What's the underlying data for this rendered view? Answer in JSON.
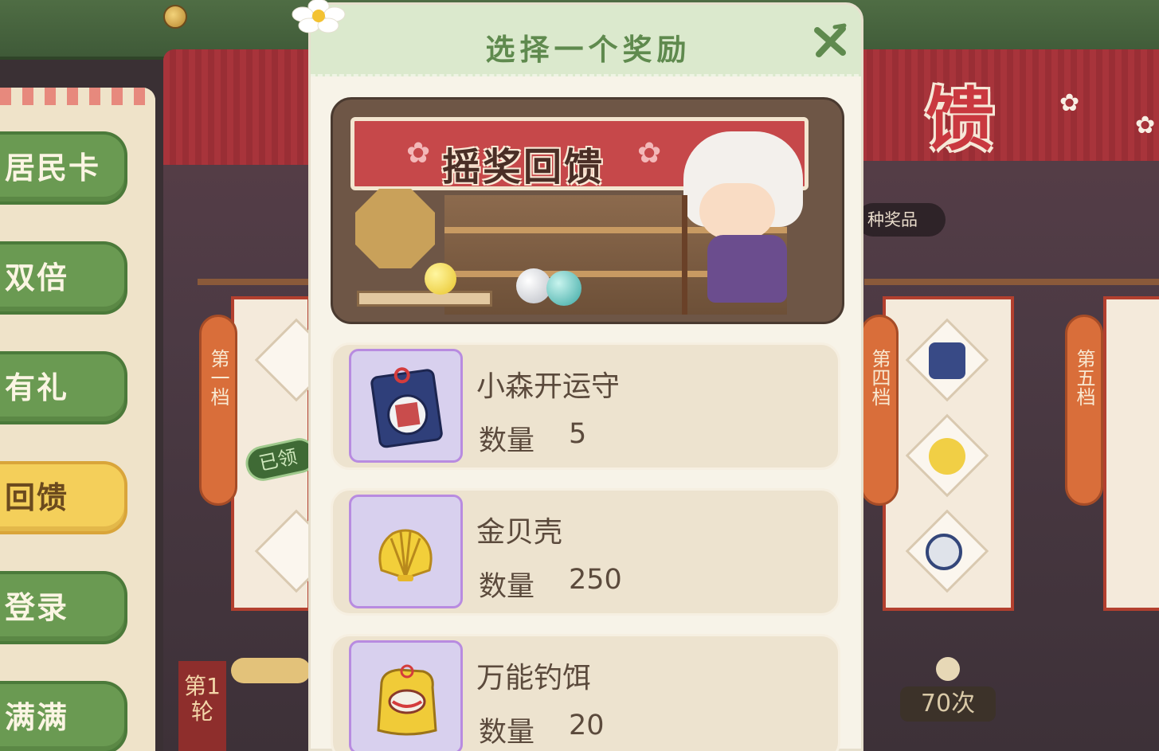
{
  "dialog": {
    "title": "选择一个奖励",
    "close_icon": "close-x-icon",
    "banner_text": "摇奖回馈"
  },
  "rewards": [
    {
      "name": "小森开运守",
      "qty_label": "数量",
      "qty": "5",
      "icon": "charm-amulet-icon"
    },
    {
      "name": "金贝壳",
      "qty_label": "数量",
      "qty": "250",
      "icon": "gold-shell-icon"
    },
    {
      "name": "万能钓饵",
      "qty_label": "数量",
      "qty": "20",
      "icon": "bait-bag-icon"
    }
  ],
  "sidebar": {
    "items": [
      {
        "label": "居民卡",
        "active": false
      },
      {
        "label": "双倍",
        "active": false
      },
      {
        "label": "有礼",
        "active": false
      },
      {
        "label": "回馈",
        "active": true
      },
      {
        "label": "登录",
        "active": false
      },
      {
        "label": "满满",
        "active": false
      }
    ]
  },
  "background": {
    "big_char": "馈",
    "prizes_pill": "种奖品",
    "tier_1": "第一档",
    "tier_4": "第四档",
    "tier_5": "第五档",
    "claimed_badge": "已领",
    "round_tag": "第1轮",
    "count_badge": "70次"
  },
  "colors": {
    "header_green": "#dbe9cd",
    "title_green": "#5f8a4e",
    "card_bg": "#ede3cf",
    "icon_box": "#d8d0ee",
    "icon_border": "#b88be0",
    "menu_green": "#6a9a52",
    "menu_active": "#f4cf5a"
  }
}
